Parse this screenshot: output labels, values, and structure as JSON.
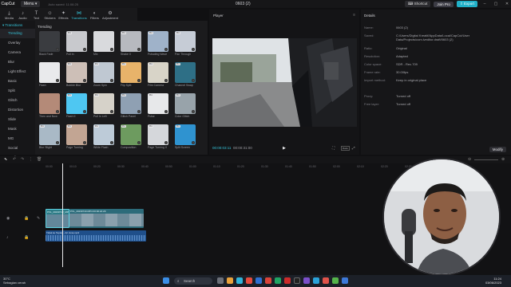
{
  "app": {
    "logo": "CapCut",
    "menu_label": "Menu",
    "autosave": "Auto saved: 11:06:25",
    "project_title": "0603 (2)"
  },
  "titlebar": {
    "shortcut": "Shortcut",
    "join_pro": "Join Pro",
    "export": "Export"
  },
  "toolbar": [
    {
      "icon": "import-icon",
      "label": "Media",
      "active": false
    },
    {
      "icon": "audio-icon",
      "label": "Audio",
      "active": false
    },
    {
      "icon": "text-icon",
      "label": "Text",
      "active": false
    },
    {
      "icon": "sticker-icon",
      "label": "Stickers",
      "active": false
    },
    {
      "icon": "effects-icon",
      "label": "Effects",
      "active": false
    },
    {
      "icon": "transitions-icon",
      "label": "Transitions",
      "active": true
    },
    {
      "icon": "filters-icon",
      "label": "Filters",
      "active": false
    },
    {
      "icon": "adjustment-icon",
      "label": "Adjustment",
      "active": false
    }
  ],
  "sidebar": {
    "header": "▾ Transitions",
    "categories": [
      "Trending",
      "Overlay",
      "Camera",
      "Blur",
      "Light Effect",
      "Basic",
      "Split",
      "Glitch",
      "Distortion",
      "Slide",
      "Mask",
      "MG",
      "Social Media"
    ],
    "active_index": 0
  },
  "media": {
    "section_title": "Trending",
    "items": [
      {
        "label": "Black Fade",
        "color": "#3a3c40",
        "pro": false
      },
      {
        "label": "Pull in",
        "color": "#c8c9cd",
        "pro": true
      },
      {
        "label": "Mix",
        "color": "#d9dadd",
        "pro": false
      },
      {
        "label": "Shake II",
        "color": "#b7b9bf",
        "pro": true
      },
      {
        "label": "Pulsating Wave",
        "color": "#9fb2c9",
        "pro": true
      },
      {
        "label": "Pan Through",
        "color": "#c6ccd6",
        "pro": true
      },
      {
        "label": "Flash",
        "color": "#e9eaec",
        "pro": false
      },
      {
        "label": "Bubble Blur",
        "color": "#cdbfb7",
        "pro": true
      },
      {
        "label": "Zoom Spin",
        "color": "#bfc8d2",
        "pro": true
      },
      {
        "label": "Flip Split",
        "color": "#e8b36a",
        "pro": true
      },
      {
        "label": "Film Camera",
        "color": "#d8d4c8",
        "pro": true
      },
      {
        "label": "Channel Swap",
        "color": "#2e6f86",
        "pro": true
      },
      {
        "label": "Then and Now",
        "color": "#b48a78",
        "pro": false
      },
      {
        "label": "Flash II",
        "color": "#4ec7f2",
        "pro": true
      },
      {
        "label": "Pull In Left",
        "color": "#d6d2c9",
        "pro": true
      },
      {
        "label": "Glitch Panel",
        "color": "#8fa0b3",
        "pro": true
      },
      {
        "label": "Pulse",
        "color": "#e7e8ea",
        "pro": true
      },
      {
        "label": "Color Glitch",
        "color": "#98a3aa",
        "pro": true
      },
      {
        "label": "Blur Slight",
        "color": "#a9b9c6",
        "pro": true
      },
      {
        "label": "Page Turning",
        "color": "#c2a593",
        "pro": true
      },
      {
        "label": "White Flash",
        "color": "#bdcbd8",
        "pro": true
      },
      {
        "label": "Composition",
        "color": "#6d9b5f",
        "pro": true
      },
      {
        "label": "Page Turning II",
        "color": "#d5d7db",
        "pro": true
      },
      {
        "label": "Split Screen",
        "color": "#2f93d0",
        "pro": true
      }
    ]
  },
  "player": {
    "title": "Player",
    "time_current": "00:00:03:11",
    "time_total": "00:00:31:00",
    "ratio_label": "Ratio"
  },
  "details": {
    "title": "Details",
    "rows": [
      {
        "k": "Name:",
        "v": "0603 (2)"
      },
      {
        "k": "Saved:",
        "v": "C:/Users/Digital Kreatif/AppData/Local/CapCut/User Data/Projects/com.lveditor.draft/0603 (2)"
      },
      {
        "k": "Ratio:",
        "v": "Original"
      },
      {
        "k": "Resolution:",
        "v": "Adapted"
      },
      {
        "k": "Color space:",
        "v": "SDR - Rec.709"
      },
      {
        "k": "Frame rate:",
        "v": "30.00fps"
      },
      {
        "k": "Import method:",
        "v": "Keep in original place"
      },
      {
        "k": "Proxy:",
        "v": "Turned off"
      },
      {
        "k": "Free layer:",
        "v": "Turned off"
      }
    ],
    "modify": "Modify"
  },
  "timeline": {
    "ruler": [
      "00:00",
      "00:10",
      "00:20",
      "00:30",
      "00:40",
      "00:50",
      "01:00",
      "01:10",
      "01:20",
      "01:30",
      "01:40",
      "01:50",
      "02:00",
      "02:10",
      "02:20",
      "02:30",
      "02:40",
      "02:50"
    ],
    "clip1_label": "PXL_20230712_MP4",
    "clip2_label": "PXL_20230743.MP4 00:00:22:29",
    "audio_label": "Tidak ke Tepian - Ari Juna.mp3"
  },
  "taskbar": {
    "weather_temp": "30°C",
    "weather_text": "Sebagian cerah",
    "search": "Search",
    "time": "11:24",
    "date": "03/06/2023"
  }
}
